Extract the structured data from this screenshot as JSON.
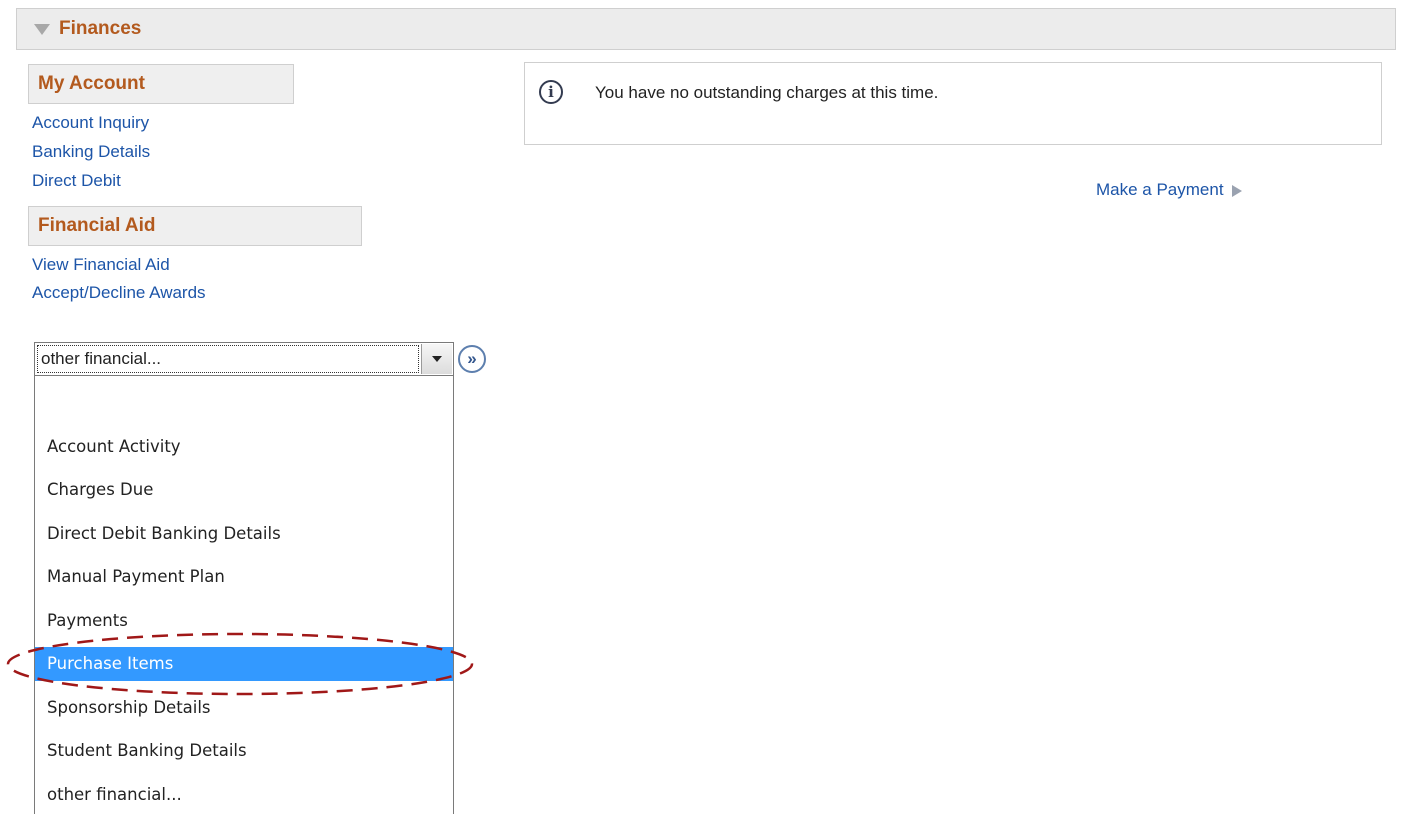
{
  "section": {
    "title": "Finances"
  },
  "my_account": {
    "heading": "My Account",
    "links": [
      "Account Inquiry",
      "Banking Details",
      "Direct Debit"
    ]
  },
  "financial_aid": {
    "heading": "Financial Aid",
    "links": [
      "View Financial Aid",
      "Accept/Decline Awards"
    ]
  },
  "info": {
    "message": "You have no outstanding charges at this time."
  },
  "payment": {
    "link_label": "Make a Payment"
  },
  "dropdown": {
    "selected_value": "other financial...",
    "go_label": "»",
    "options": [
      "",
      "Account Activity",
      "Charges Due",
      "Direct Debit Banking Details",
      "Manual Payment Plan",
      "Payments",
      "Purchase Items",
      "Sponsorship Details",
      "Student Banking Details",
      "other financial..."
    ],
    "highlighted_option": "Purchase Items"
  },
  "colors": {
    "header_text": "#b35a1e",
    "link": "#1d55a8",
    "highlight": "#3399ff",
    "annotation": "#a01818"
  }
}
